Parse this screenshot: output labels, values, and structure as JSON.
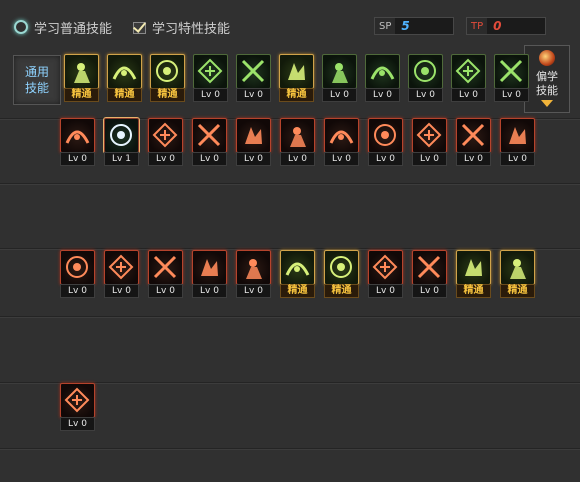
{
  "tabs": [
    {
      "label": "学习普通技能",
      "type": "radio"
    },
    {
      "label": "学习特性技能",
      "type": "check"
    }
  ],
  "sp": [
    {
      "tag": "SP",
      "value": "5",
      "color": "#4fb3ff"
    },
    {
      "tag": "TP",
      "value": "0",
      "color": "#e24b3a"
    }
  ],
  "side_label": "通用技能",
  "side_toggle": {
    "label": "偏学技能"
  },
  "levels": {
    "master": "精通",
    "lv0": "Lv 0",
    "lv1": "Lv 1"
  },
  "rows": [
    {
      "name": "common",
      "skills": [
        {
          "icon": "sit-meditate-icon",
          "style": "gold",
          "label": "精通"
        },
        {
          "icon": "rise-figure-icon",
          "style": "gold",
          "label": "精通"
        },
        {
          "icon": "dash-figure-icon",
          "style": "gold",
          "label": "精通"
        },
        {
          "icon": "wings-icon",
          "style": "green",
          "label": "Lv 0"
        },
        {
          "icon": "target-icon",
          "style": "green",
          "label": "Lv 0"
        },
        {
          "icon": "target-gold-icon",
          "style": "gold",
          "label": "精通"
        },
        {
          "icon": "kneel-figure-icon",
          "style": "green",
          "label": "Lv 0"
        },
        {
          "icon": "orb-figure-icon",
          "style": "green",
          "label": "Lv 0"
        },
        {
          "icon": "eye-icon",
          "style": "green",
          "label": "Lv 0"
        },
        {
          "icon": "armor-figure-icon",
          "style": "green",
          "label": "Lv 0"
        },
        {
          "icon": "swing-figure-icon",
          "style": "green",
          "label": "Lv 0"
        }
      ]
    },
    {
      "name": "row2",
      "skills": [
        {
          "icon": "fire-slash-icon",
          "style": "red",
          "label": "Lv 0"
        },
        {
          "icon": "moon-cross-icon",
          "style": "active",
          "label": "Lv 1"
        },
        {
          "icon": "crescent-icon",
          "style": "red",
          "label": "Lv 0"
        },
        {
          "icon": "rune-circle-icon",
          "style": "red",
          "label": "Lv 0"
        },
        {
          "icon": "crossed-blades-icon",
          "style": "red",
          "label": "Lv 0"
        },
        {
          "icon": "fist-icon",
          "style": "red",
          "label": "Lv 0"
        },
        {
          "icon": "shield-book-icon",
          "style": "red",
          "label": "Lv 0"
        },
        {
          "icon": "flame-hand-icon",
          "style": "red",
          "label": "Lv 0"
        },
        {
          "icon": "claw-swipe-icon",
          "style": "red",
          "label": "Lv 0"
        },
        {
          "icon": "punch-icon",
          "style": "red",
          "label": "Lv 0"
        },
        {
          "icon": "vortex-figure-icon",
          "style": "red",
          "label": "Lv 0"
        }
      ]
    },
    {
      "name": "row3",
      "skills": [
        {
          "icon": "slash-arc-icon",
          "style": "red",
          "label": "Lv 0"
        },
        {
          "icon": "spark-burst-icon",
          "style": "red",
          "label": "Lv 0"
        },
        {
          "icon": "run-figure-icon",
          "style": "red",
          "label": "Lv 0"
        },
        {
          "icon": "blast-icon",
          "style": "red",
          "label": "Lv 0"
        },
        {
          "icon": "dark-orb-icon",
          "style": "red",
          "label": "Lv 0"
        },
        {
          "icon": "explosion-icon",
          "style": "gold",
          "label": "精通"
        },
        {
          "icon": "beast-burst-icon",
          "style": "gold",
          "label": "精通"
        },
        {
          "icon": "pillar-light-icon",
          "style": "red",
          "label": "Lv 0"
        },
        {
          "icon": "wind-ring-icon",
          "style": "red",
          "label": "Lv 0"
        },
        {
          "icon": "fortress-icon",
          "style": "gold",
          "label": "精通"
        },
        {
          "icon": "tornado-figure-icon",
          "style": "gold",
          "label": "精通"
        }
      ]
    },
    {
      "name": "row4",
      "skills": [
        {
          "icon": "spiral-icon",
          "style": "red",
          "label": "Lv 0"
        }
      ]
    }
  ]
}
